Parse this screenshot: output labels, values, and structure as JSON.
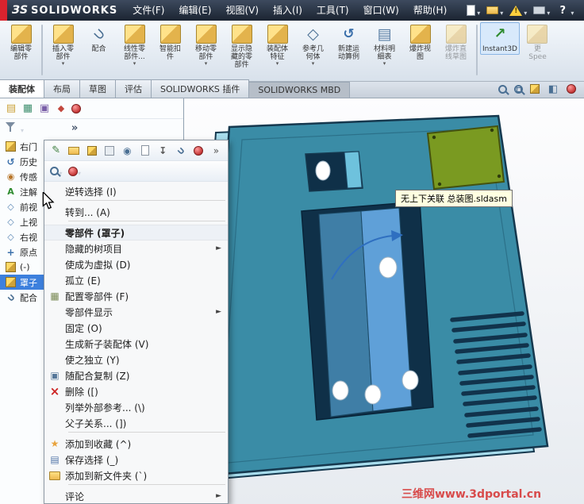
{
  "menubar": {
    "brand_mark": "ЗS",
    "brand_name": "SOLIDWORKS",
    "menus": [
      "文件(F)",
      "编辑(E)",
      "视图(V)",
      "插入(I)",
      "工具(T)",
      "窗口(W)",
      "帮助(H)"
    ],
    "quick_icons": [
      "new-document-icon",
      "open-icon",
      "alert-icon",
      "print-icon",
      "help-icon"
    ]
  },
  "ribbon": {
    "buttons": [
      {
        "name": "edit-component-button",
        "icon": "edit-component-ribbon-icon",
        "line1": "编辑零",
        "line2": "部件"
      },
      {
        "type": "separator"
      },
      {
        "name": "insert-component-button",
        "icon": "insert-component-ribbon-icon",
        "line1": "插入零",
        "line2": "部件",
        "dropdown": true
      },
      {
        "name": "mate-button",
        "icon": "mate-ribbon-icon",
        "line1": "配合"
      },
      {
        "name": "linear-pattern-button",
        "icon": "linear-pattern-ribbon-icon",
        "line1": "线性零",
        "line2": "部件...",
        "dropdown": true
      },
      {
        "name": "smart-fasteners-button",
        "icon": "smart-fasteners-ribbon-icon",
        "line1": "智能扣",
        "line2": "件"
      },
      {
        "name": "move-component-button",
        "icon": "move-component-ribbon-icon",
        "line1": "移动零",
        "line2": "部件",
        "dropdown": true
      },
      {
        "name": "show-hidden-components-button",
        "icon": "show-hidden-ribbon-icon",
        "line1": "显示隐",
        "line2": "藏的零",
        "line3": "部件"
      },
      {
        "name": "assembly-features-button",
        "icon": "assembly-features-ribbon-icon",
        "line1": "装配体",
        "line2": "特征",
        "dropdown": true
      },
      {
        "name": "reference-geometry-button",
        "icon": "reference-geometry-ribbon-icon",
        "line1": "参考几",
        "line2": "何体",
        "dropdown": true
      },
      {
        "name": "new-motion-study-button",
        "icon": "motion-study-ribbon-icon",
        "line1": "新建运",
        "line2": "动算例"
      },
      {
        "name": "bill-of-materials-button",
        "icon": "bom-ribbon-icon",
        "line1": "材料明",
        "line2": "细表",
        "dropdown": true
      },
      {
        "name": "exploded-view-button",
        "icon": "exploded-view-ribbon-icon",
        "line1": "爆炸视",
        "line2": "图"
      },
      {
        "name": "explode-line-sketch-button",
        "icon": "explode-line-sketch-ribbon-icon",
        "line1": "爆炸直",
        "line2": "线草图",
        "state": "disabled"
      },
      {
        "type": "separator"
      },
      {
        "name": "instant3d-button",
        "icon": "instant3d-ribbon-icon",
        "line1": "Instant3D",
        "state": "active"
      },
      {
        "name": "truncated-right-button",
        "icon": "speedpak-ribbon-icon",
        "line1": "更",
        "line2": "Spee",
        "state": "disabled"
      }
    ]
  },
  "tabrow": {
    "tabs": [
      {
        "name": "tab-assembly",
        "label": "装配体",
        "state": "active"
      },
      {
        "name": "tab-layout",
        "label": "布局"
      },
      {
        "name": "tab-sketch",
        "label": "草图"
      },
      {
        "name": "tab-evaluate",
        "label": "评估"
      },
      {
        "name": "tab-solidworks-addins",
        "label": "SOLIDWORKS 插件"
      },
      {
        "name": "tab-solidworks-mbd",
        "label": "SOLIDWORKS MBD",
        "state": "dark"
      }
    ],
    "right_icons": [
      "zoom-fit-icon",
      "zoom-area-icon",
      "display-style-icon",
      "section-view-icon",
      "appearance-ball-icon"
    ]
  },
  "feature_panel": {
    "header_icons": [
      "design-tree-icon",
      "property-manager-icon",
      "configuration-manager-icon",
      "dimxpert-icon",
      "display-manager-icon"
    ],
    "tree": [
      {
        "icon": "assembly-icon",
        "label": "右门"
      },
      {
        "icon": "history-icon",
        "label": "历史"
      },
      {
        "icon": "sensor-icon",
        "label": "传感"
      },
      {
        "icon": "annotations-icon",
        "label": "注解"
      },
      {
        "icon": "plane-icon",
        "label": "前视"
      },
      {
        "icon": "plane-icon",
        "label": "上视"
      },
      {
        "icon": "plane-icon",
        "label": "右视"
      },
      {
        "icon": "origin-icon",
        "label": "原点"
      },
      {
        "icon": "component-icon",
        "label": "(-)"
      },
      {
        "icon": "component-icon",
        "label": "罩子",
        "selected": true
      },
      {
        "icon": "mates-icon",
        "label": "配合"
      }
    ]
  },
  "context_menu": {
    "toolbar_row1": [
      "edit-component-icon",
      "open-part-icon",
      "isolate-icon",
      "suppress-icon",
      "hide-component-icon",
      "component-properties-icon",
      "fix-icon",
      "mate-icon",
      "appearance-icon",
      "more-icon"
    ],
    "toolbar_row2": [
      "zoom-to-fit-icon",
      "appearance-ball-icon"
    ],
    "items": [
      {
        "type": "item",
        "label": "逆转选择 (I)"
      },
      {
        "type": "separator"
      },
      {
        "type": "item",
        "label": "转到... (A)"
      },
      {
        "type": "separator"
      },
      {
        "type": "header",
        "label": "零部件 (罩子)"
      },
      {
        "type": "item",
        "label": "隐藏的树项目",
        "submenu": true
      },
      {
        "type": "item",
        "label": "使成为虚拟 (D)"
      },
      {
        "type": "item",
        "label": "孤立 (E)"
      },
      {
        "type": "item",
        "label": "配置零部件 (F)",
        "icon": "configure-icon"
      },
      {
        "type": "item",
        "label": "零部件显示",
        "submenu": true
      },
      {
        "type": "item",
        "label": "固定 (O)"
      },
      {
        "type": "item",
        "label": "生成新子装配体 (V)"
      },
      {
        "type": "item",
        "label": "使之独立 (Y)"
      },
      {
        "type": "item",
        "label": "随配合复制 (Z)",
        "icon": "copy-mates-icon"
      },
      {
        "type": "item",
        "label": "删除 ([)",
        "icon": "delete-icon"
      },
      {
        "type": "item",
        "label": "列举外部参考... (\\)"
      },
      {
        "type": "item",
        "label": "父子关系... (])"
      },
      {
        "type": "separator"
      },
      {
        "type": "item",
        "label": "添加到收藏 (^)",
        "icon": "favorite-icon"
      },
      {
        "type": "item",
        "label": "保存选择 (_)",
        "icon": "save-selection-icon"
      },
      {
        "type": "item",
        "label": "添加到新文件夹 (`)",
        "icon": "new-folder-icon"
      },
      {
        "type": "separator"
      },
      {
        "type": "item",
        "label": "评论",
        "submenu": true
      }
    ]
  },
  "viewport": {
    "tooltip": "无上下关联 总装图.sldasm",
    "watermark": "三维网www.3dportal.cn",
    "colors": {
      "panel_front": "#3a8ca6",
      "panel_side": "#a7dcec",
      "panel_edge": "#15384e",
      "opening": "#0f3048",
      "inner_left": "#3f7ea6",
      "inner_right": "#5fa0d8",
      "cutout_tab": "#6ec2dd",
      "board": "#7a9a21",
      "board_edge": "#44520f",
      "hole": "#ffffff",
      "hole_edge": "#9fb4c4",
      "vent": "#11334c",
      "arrow": "#2f6fc0"
    }
  }
}
